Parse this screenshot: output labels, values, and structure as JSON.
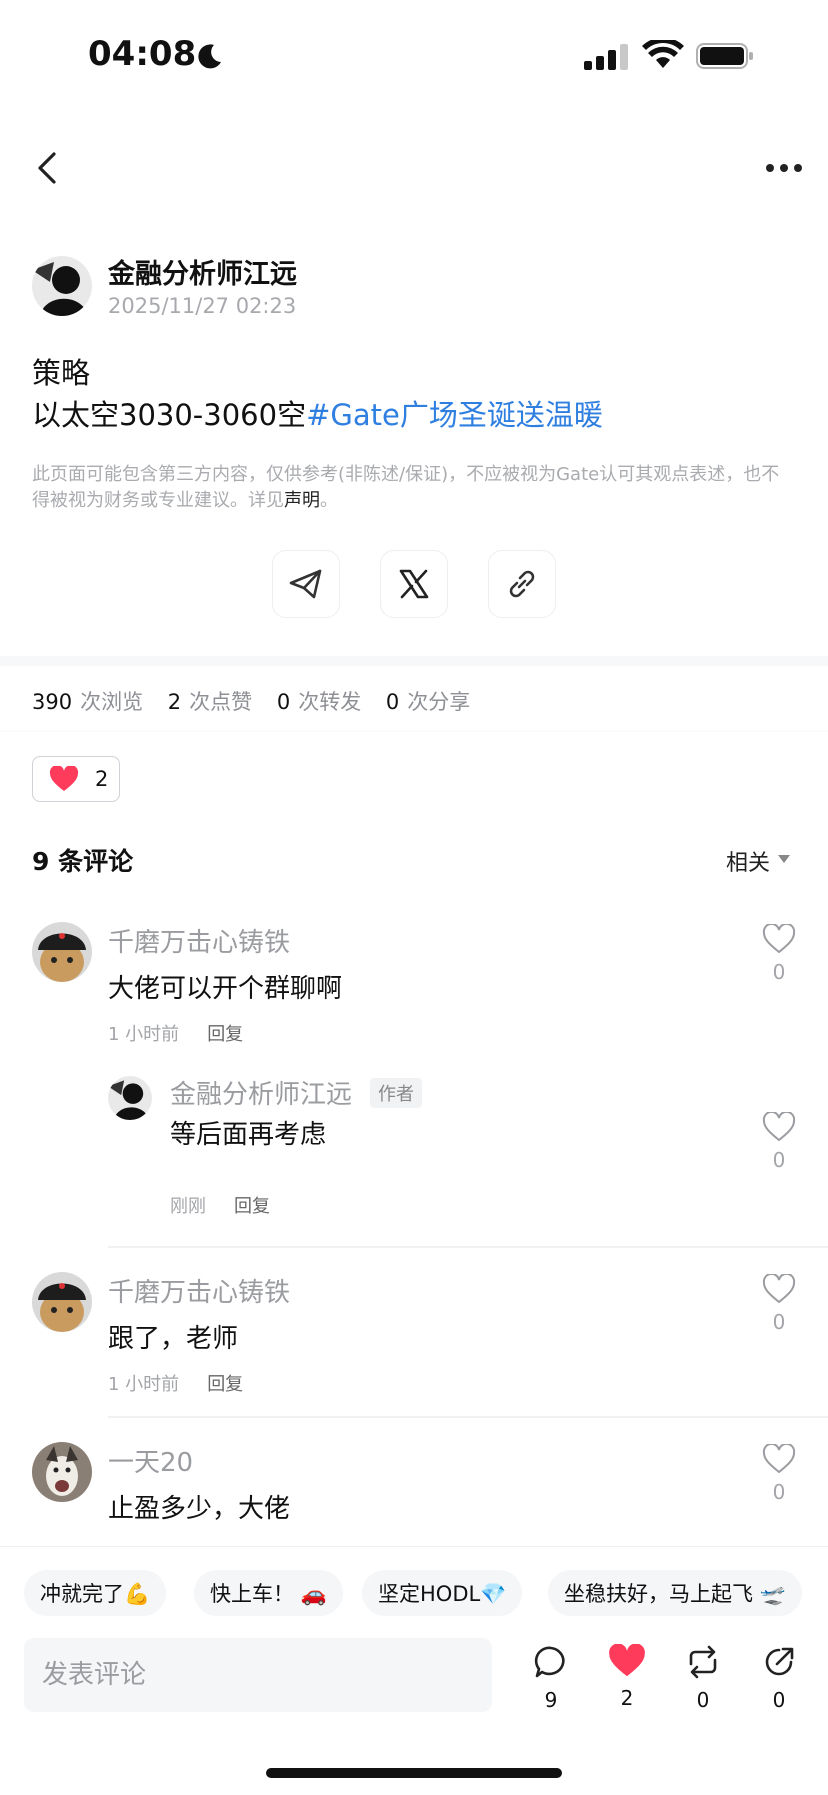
{
  "status_bar": {
    "time": "04:08"
  },
  "author": {
    "name": "金融分析师江远",
    "time": "2025/11/27 02:23"
  },
  "post": {
    "title": "策略",
    "body_prefix": "以太空3030-3060空",
    "hashtag": "#Gate广场圣诞送温暖"
  },
  "disclaimer": {
    "text": "此页面可能包含第三方内容，仅供参考(非陈述/保证)，不应被视为Gate认可其观点表述，也不得被视为财务或专业建议。详见",
    "link": "声明",
    "end": "。"
  },
  "share": [
    {
      "icon": "telegram-icon"
    },
    {
      "icon": "x-icon"
    },
    {
      "icon": "link-icon"
    }
  ],
  "stats": {
    "views": "390",
    "views_label": "次浏览",
    "likes": "2",
    "likes_label": "次点赞",
    "reposts": "0",
    "reposts_label": "次转发",
    "shares": "0",
    "shares_label": "次分享"
  },
  "like_pill": {
    "count": "2"
  },
  "comments_header": {
    "title": "9 条评论",
    "sort": "相关"
  },
  "comments": [
    {
      "name": "千磨万击心铸铁",
      "text": "大佬可以开个群聊啊",
      "time": "1 小时前",
      "reply": "回复",
      "likes": "0",
      "replies": [
        {
          "name": "金融分析师江远",
          "badge": "作者",
          "text": "等后面再考虑",
          "time": "刚刚",
          "reply": "回复",
          "likes": "0"
        }
      ]
    },
    {
      "name": "千磨万击心铸铁",
      "text": "跟了，老师",
      "time": "1 小时前",
      "reply": "回复",
      "likes": "0"
    },
    {
      "name": "一天20",
      "text": "止盈多少，大佬",
      "likes": "0"
    }
  ],
  "quick_replies": [
    "冲就完了💪",
    "快上车！ 🚗",
    "坚定HODL💎",
    "坐稳扶好，马上起飞 🛫"
  ],
  "composer": {
    "placeholder": "发表评论"
  },
  "actions": [
    {
      "icon": "comment-icon",
      "count": "9"
    },
    {
      "icon": "heart-icon",
      "count": "2"
    },
    {
      "icon": "repost-icon",
      "count": "0"
    },
    {
      "icon": "share-icon",
      "count": "0"
    }
  ],
  "colors": {
    "accent": "#2f7fe0",
    "heart": "#ff3b5c"
  }
}
